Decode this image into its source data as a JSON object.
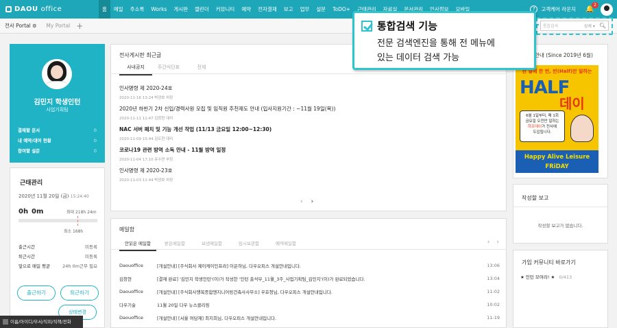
{
  "app": {
    "logo_brand": "DAOU",
    "logo_suffix": "office"
  },
  "nav": [
    "홈",
    "메일",
    "주소록",
    "Works",
    "게시판",
    "캘린더",
    "커뮤니티",
    "예약",
    "전자결재",
    "보고",
    "업무",
    "설문",
    "ToDO+",
    "근태관리",
    "자료실",
    "문서관리",
    "인사정보",
    "모바일"
  ],
  "user": {
    "name": "고객케어 라운지",
    "notifications": "2"
  },
  "portal_tabs": {
    "company": "전사 Portal",
    "my": "My Portal"
  },
  "search": {
    "placeholder": "통합검색",
    "detail": "상세 ▾"
  },
  "callout": {
    "title": "통합검색 기능",
    "line1": "전문 검색엔진을 통해 전 메뉴에",
    "line2": "있는 데이터 검색 가능"
  },
  "profile": {
    "name": "김민지 학생인턴",
    "dept": "사업기획팀",
    "stats": [
      {
        "label": "결재할 문서",
        "value": "0"
      },
      {
        "label": "내 예약/대여 현황",
        "value": "0"
      },
      {
        "label": "참여할 설문",
        "value": "0"
      }
    ]
  },
  "attendance": {
    "title": "근태관리",
    "date": "2020년 11월 20일 (금)",
    "clock": "15:24:40",
    "hours": "0",
    "hours_unit": "h",
    "minutes": "0",
    "minutes_unit": "m",
    "max": "최대 218h 24m",
    "min": "최소 168h",
    "rows": [
      {
        "label": "출근시간",
        "value": "미등록"
      },
      {
        "label": "퇴근시간",
        "value": "미등록"
      },
      {
        "label": "앞으로 매일 평균",
        "value": "24h 0m근무 필요"
      }
    ],
    "btn_in": "출근하기",
    "btn_out": "퇴근하기",
    "btn_status": "상태변경"
  },
  "board": {
    "title": "전사게시판 최근글",
    "tabs": [
      "사내공지",
      "주간식단표",
      "전체"
    ],
    "posts": [
      {
        "title": "인사명령 제 2020-24호",
        "meta": "2020-11-16 13:24   박광호 차장",
        "bold": false
      },
      {
        "title": "2020년 하반기 2차 신입/경력사원 모집 및 임직원 추천제도 안내 (입사지원기간 : ~11월 19일(목))",
        "meta": "2020-11-11 11:47   김창현 대리",
        "bold": false
      },
      {
        "title": "NAC 서버 패치 및 기능 개선 작업 (11/13 금요일 12:00~12:30)",
        "meta": "2020-11-09 15:44   김도현 대리",
        "bold": true
      },
      {
        "title": "코로나19 관련 방역 소독 안내 - 11월 방역 일정",
        "meta": "2020-11-04 17:10   유수연 부장",
        "bold": true
      },
      {
        "title": "인사명령 제 2020-23호",
        "meta": "2020-11-03 11:44   박광호 차장",
        "bold": false
      }
    ]
  },
  "mail": {
    "title": "메일함",
    "tabs": [
      "안읽은 메일함",
      "받은메일함",
      "보낸메일함",
      "임시보관함",
      "예약메일함"
    ],
    "rows": [
      {
        "from": "Daouoffice",
        "subject": "[개설안내] [주식회사 제이케이인프라] 이은하님, 다우오피스 개설안내입니다.",
        "time": "13:06"
      },
      {
        "from": "김창현",
        "subject": "[결재 완료] '김민지 학생인턴'(이)가 작성한 '인턴 출석부_11월_3주_사업기획팀_김민지'(이)가 완료되었습니다.",
        "time": "13:04"
      },
      {
        "from": "Daouoffice",
        "subject": "[개설안내] [주식회사행복종합엔지니어링건축사사무소] 우효청님, 다우오피스 개설안내입니다.",
        "time": "11:02"
      },
      {
        "from": "다우기술",
        "subject": "11월 20일 다우 뉴스클리핑",
        "time": "10:02"
      },
      {
        "from": "Daouoffice",
        "subject": "[개설안내] [서울 여담재] 최지희님, 다우오피스 개설안내입니다.",
        "time": "11-19"
      }
    ]
  },
  "banner": {
    "title": "LF Day 안내 (Since 2019년 6월)",
    "headline": "한 달에 한 번, 반(Half)만 일하는",
    "big": "HALF",
    "dei": "데이",
    "bubble1": "6월 1일부터, 매 1회",
    "bubble2": "금요일 오전만 일하는",
    "bubble3": "하프데이",
    "bubble4": "가 전사에",
    "bubble5": "도입됩니다.",
    "foot1": "Happy Alive Leisure",
    "foot2": "FRiDAY"
  },
  "report": {
    "title": "작성할 보고",
    "empty": "작성할 보고가 없습니다."
  },
  "community": {
    "title": "가입 커뮤니티 바로가기",
    "item": "★ 인턴 모여라! ★",
    "count": "0/413"
  },
  "directory": {
    "placeholder": "이름/아이디/부서/직위/직책/전화"
  }
}
